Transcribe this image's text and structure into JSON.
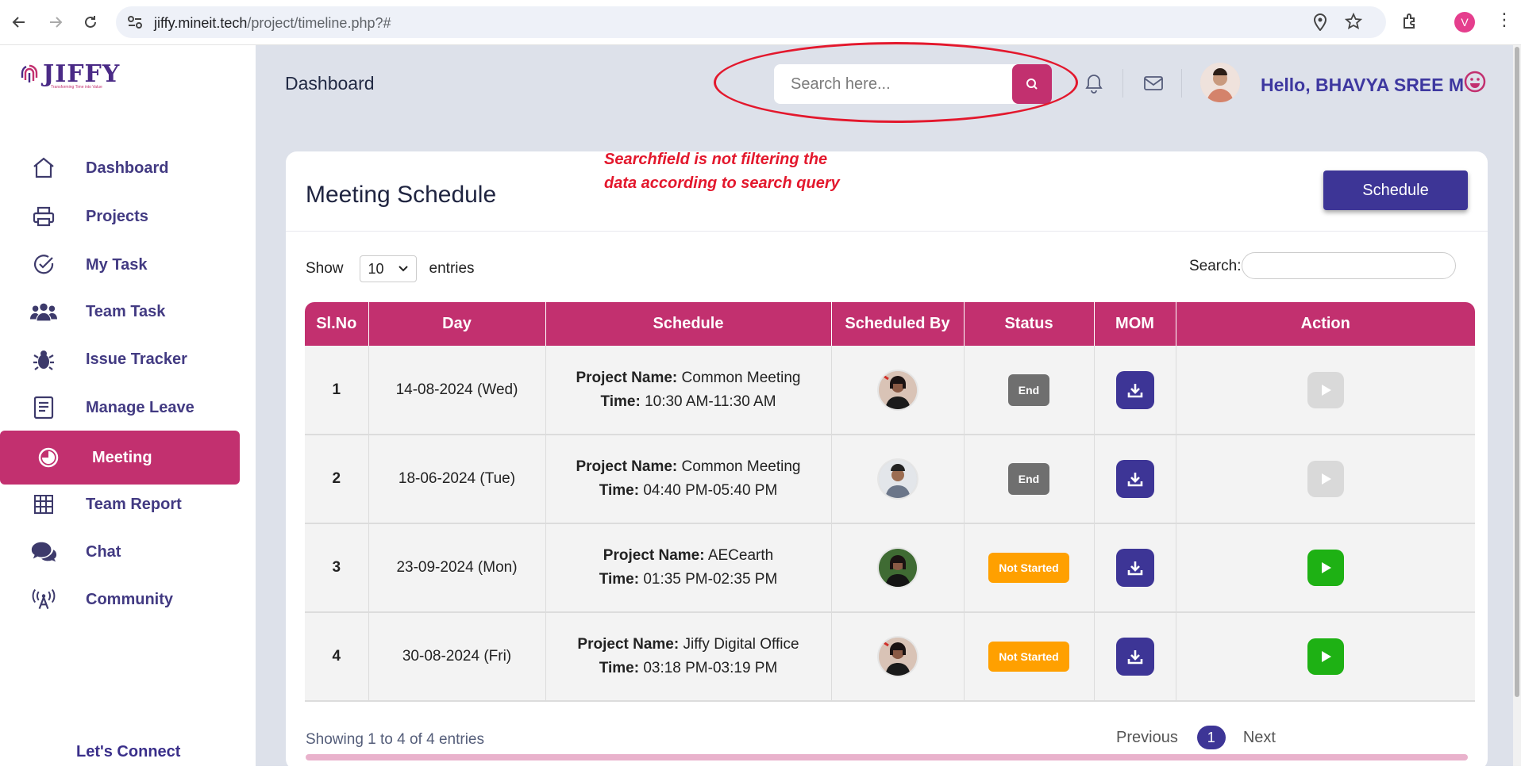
{
  "browser": {
    "url_host": "jiffy.mineit.tech",
    "url_path": "/project/timeline.php?#",
    "profile_initial": "V"
  },
  "sidebar": {
    "logo_text": "JIFFY",
    "logo_tagline": "Transforming Time into Value",
    "items": [
      {
        "label": "Dashboard",
        "icon": "home-icon"
      },
      {
        "label": "Projects",
        "icon": "printer-icon"
      },
      {
        "label": "My Task",
        "icon": "check-circle-icon"
      },
      {
        "label": "Team Task",
        "icon": "users-icon"
      },
      {
        "label": "Issue Tracker",
        "icon": "bug-icon"
      },
      {
        "label": "Manage Leave",
        "icon": "document-icon"
      },
      {
        "label": "Meeting",
        "icon": "meeting-icon",
        "active": true
      },
      {
        "label": "Team Report",
        "icon": "grid-icon"
      },
      {
        "label": "Chat",
        "icon": "chat-icon"
      },
      {
        "label": "Community",
        "icon": "broadcast-icon"
      }
    ],
    "lets_connect": "Let's Connect"
  },
  "topbar": {
    "title": "Dashboard",
    "search_placeholder": "Search here...",
    "greeting": "Hello, BHAVYA SREE M"
  },
  "card": {
    "title": "Meeting Schedule",
    "annotation_line1": "Searchfield is not filtering the",
    "annotation_line2": "data according to search query",
    "schedule_button": "Schedule",
    "show_label": "Show",
    "entries_value": "10",
    "entries_label": "entries",
    "search_label": "Search:"
  },
  "table": {
    "headers": [
      "Sl.No",
      "Day",
      "Schedule",
      "Scheduled By",
      "Status",
      "MOM",
      "Action"
    ],
    "project_label": "Project Name:",
    "time_label": "Time:",
    "rows": [
      {
        "no": "1",
        "day": "14-08-2024 (Wed)",
        "project": "Common Meeting",
        "time": "10:30 AM-11:30 AM",
        "status": "End"
      },
      {
        "no": "2",
        "day": "18-06-2024 (Tue)",
        "project": "Common Meeting",
        "time": "04:40 PM-05:40 PM",
        "status": "End"
      },
      {
        "no": "3",
        "day": "23-09-2024 (Mon)",
        "project": "AECearth",
        "time": "01:35 PM-02:35 PM",
        "status": "Not Started"
      },
      {
        "no": "4",
        "day": "30-08-2024 (Fri)",
        "project": "Jiffy Digital Office",
        "time": "03:18 PM-03:19 PM",
        "status": "Not Started"
      }
    ]
  },
  "footer": {
    "info": "Showing 1 to 4 of 4 entries",
    "previous": "Previous",
    "page": "1",
    "next": "Next"
  },
  "colors": {
    "brand_pink": "#c2306f",
    "brand_purple": "#3d3596",
    "status_end": "#6f6f6f",
    "status_not_started": "#ffa000",
    "action_active": "#1eb114",
    "annotation_red": "#e3182d"
  }
}
